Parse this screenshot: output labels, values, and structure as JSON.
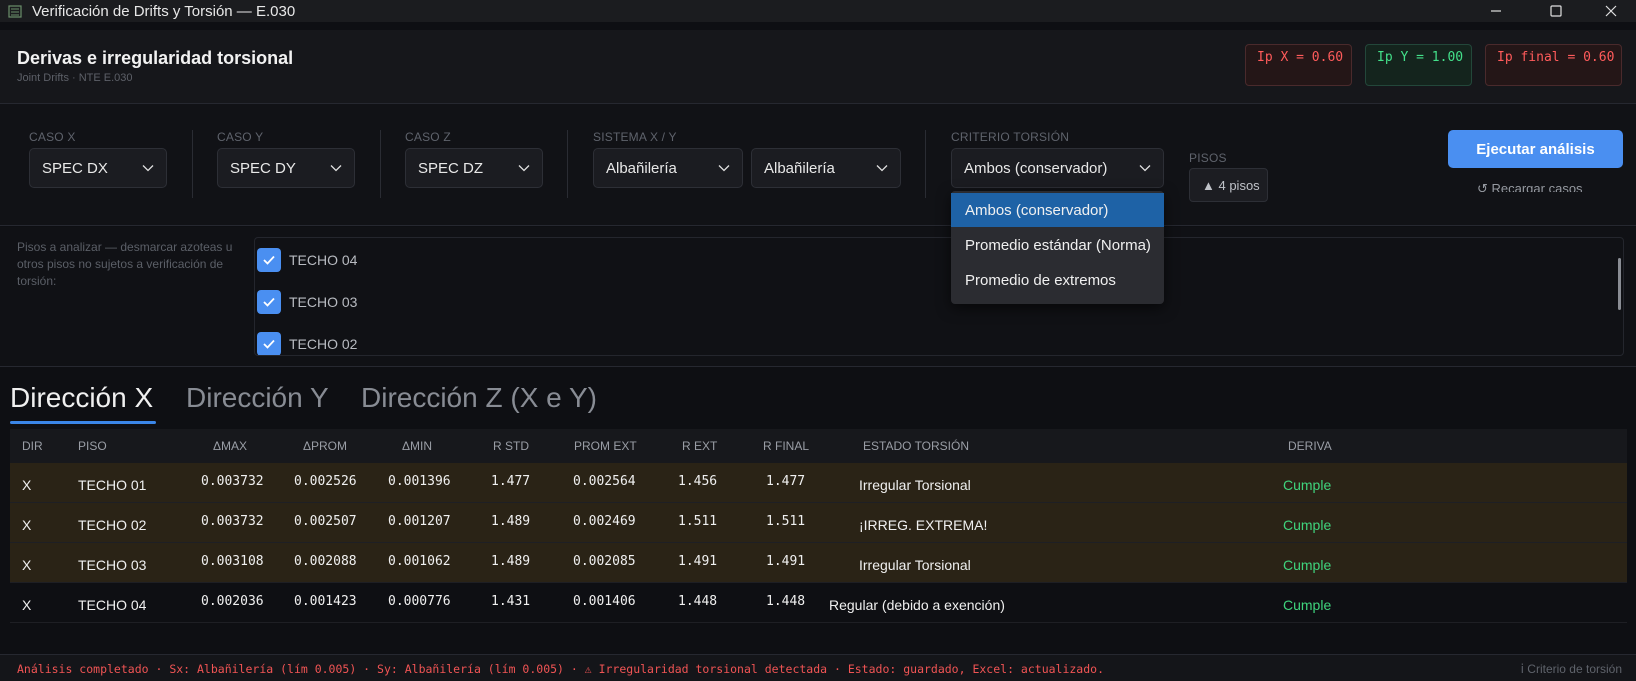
{
  "window": {
    "title": "Verificación de Drifts y Torsión — E.030",
    "controls": {
      "minimize": "—",
      "maximize": "☐",
      "close": "✕"
    }
  },
  "header": {
    "title": "Derivas e irregularidad torsional",
    "subtitle": "Joint Drifts · NTE E.030",
    "ip_cards": [
      {
        "label": "Ip X = 0.60",
        "status": "red"
      },
      {
        "label": "Ip Y = 1.00",
        "status": "green"
      },
      {
        "label": "Ip final = 0.60",
        "status": "red"
      }
    ]
  },
  "controls": {
    "caso_x": {
      "label": "CASO X",
      "value": "SPEC DX"
    },
    "caso_y": {
      "label": "CASO Y",
      "value": "SPEC DY"
    },
    "caso_z": {
      "label": "CASO Z",
      "value": "SPEC DZ"
    },
    "sistema": {
      "label": "SISTEMA X / Y",
      "value_x": "Albañilería",
      "value_y": "Albañilería"
    },
    "criterio": {
      "label": "CRITERIO TORSIÓN",
      "value": "Ambos (conservador)",
      "options": [
        "Ambos (conservador)",
        "Promedio estándar (Norma)",
        "Promedio de extremos"
      ],
      "selected_index": 0
    },
    "pisos": {
      "label": "PISOS",
      "badge": "▲ 4 pisos"
    },
    "run_button": "Ejecutar análisis",
    "reload_link": "↺ Recargar casos"
  },
  "floors": {
    "hint": "Pisos a analizar — desmarcar azoteas u otros pisos no sujetos a verificación de torsión:",
    "items": [
      {
        "label": "TECHO 04",
        "checked": true
      },
      {
        "label": "TECHO 03",
        "checked": true
      },
      {
        "label": "TECHO 02",
        "checked": true
      }
    ]
  },
  "tabs": [
    "Dirección X",
    "Dirección Y",
    "Dirección Z (X e Y)"
  ],
  "table": {
    "headers": [
      "DIR",
      "PISO",
      "ΔMAX",
      "ΔPROM",
      "ΔMIN",
      "R STD",
      "PROM EXT",
      "R EXT",
      "R FINAL",
      "ESTADO TORSIÓN",
      "DERIVA"
    ],
    "rows": [
      {
        "dir": "X",
        "piso": "TECHO 01",
        "dmax": "0.003732",
        "dprom": "0.002526",
        "dmin": "0.001396",
        "rstd": "1.477",
        "promext": "0.002564",
        "rext": "1.456",
        "rfinal": "1.477",
        "estado": "Irregular Torsional",
        "deriva": "Cumple"
      },
      {
        "dir": "X",
        "piso": "TECHO 02",
        "dmax": "0.003732",
        "dprom": "0.002507",
        "dmin": "0.001207",
        "rstd": "1.489",
        "promext": "0.002469",
        "rext": "1.511",
        "rfinal": "1.511",
        "estado": "¡IRREG. EXTREMA!",
        "deriva": "Cumple"
      },
      {
        "dir": "X",
        "piso": "TECHO 03",
        "dmax": "0.003108",
        "dprom": "0.002088",
        "dmin": "0.001062",
        "rstd": "1.489",
        "promext": "0.002085",
        "rext": "1.491",
        "rfinal": "1.491",
        "estado": "Irregular Torsional",
        "deriva": "Cumple"
      },
      {
        "dir": "X",
        "piso": "TECHO 04",
        "dmax": "0.002036",
        "dprom": "0.001423",
        "dmin": "0.000776",
        "rstd": "1.431",
        "promext": "0.001406",
        "rext": "1.448",
        "rfinal": "1.448",
        "estado": "Regular (debido a exención)",
        "deriva": "Cumple"
      }
    ]
  },
  "status": {
    "message": "Análisis completado · Sx: Albañilería (lím 0.005) · Sy: Albañilería (lím 0.005) · ⚠ Irregularidad torsional detectada · Estado: guardado, Excel: actualizado.",
    "right": "ⅰ Criterio de torsión"
  },
  "colors": {
    "accent": "#4a8ff1",
    "warn_row": "#2a2316",
    "ok_text": "#3fd47d",
    "error_text": "#f05454"
  }
}
